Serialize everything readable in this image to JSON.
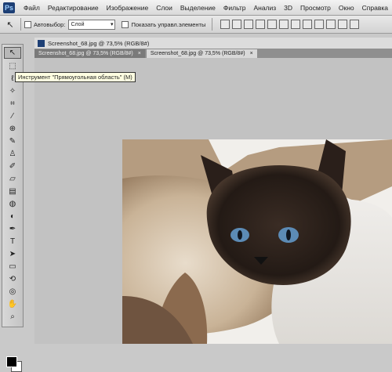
{
  "app": {
    "logo": "Ps"
  },
  "menu": [
    "Файл",
    "Редактирование",
    "Изображение",
    "Слои",
    "Выделение",
    "Фильтр",
    "Анализ",
    "3D",
    "Просмотр",
    "Окно",
    "Справка"
  ],
  "options": {
    "tool_icon": "↖",
    "autoselect_label": "Автовыбор:",
    "autoselect_value": "Слой",
    "show_controls_label": "Показать управл.элементы"
  },
  "document": {
    "title": "Screenshot_68.jpg @ 73,5% (RGB/8#)",
    "tabs": [
      {
        "label": "Screenshot_68.jpg @ 73,5% (RGB/8#)",
        "close": "×"
      },
      {
        "label": "Screenshot_68.jpg @ 73,5% (RGB/8#)",
        "close": "×"
      }
    ]
  },
  "tooltip": "Инструмент \"Прямоугольная область\" (M)",
  "tools": [
    "move-icon",
    "marquee-icon",
    "lasso-icon",
    "magic-wand-icon",
    "crop-icon",
    "eyedropper-icon",
    "healing-icon",
    "brush-icon",
    "clone-stamp-icon",
    "history-brush-icon",
    "eraser-icon",
    "gradient-icon",
    "blur-icon",
    "dodge-icon",
    "pen-icon",
    "type-icon",
    "path-select-icon",
    "shape-icon",
    "3d-rotate-icon",
    "3d-orbit-icon",
    "hand-icon",
    "zoom-icon"
  ],
  "colors": {
    "foreground": "#000000",
    "background": "#ffffff"
  }
}
